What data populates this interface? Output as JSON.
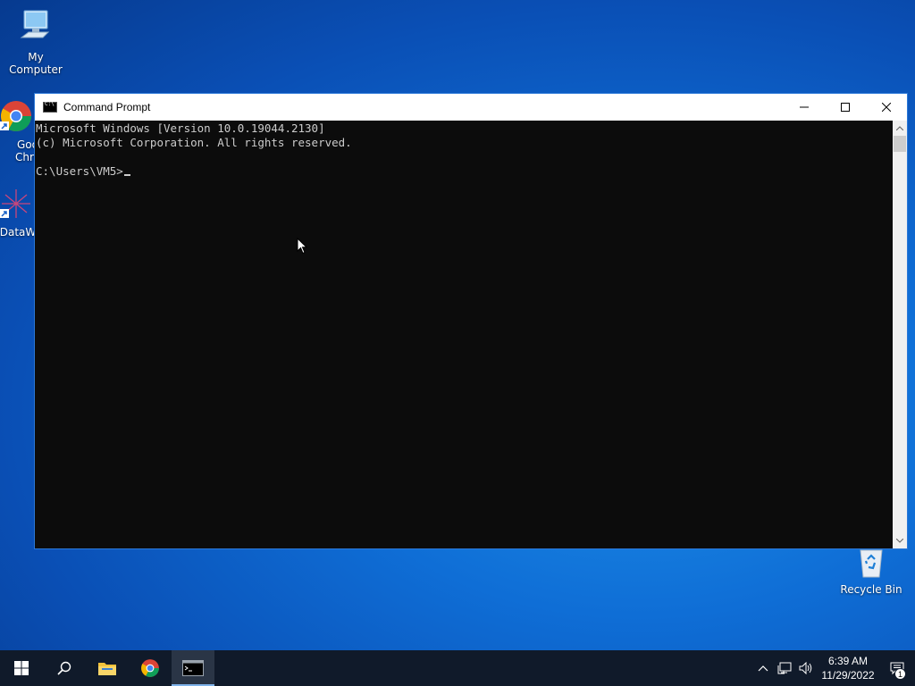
{
  "desktop": {
    "icons": [
      {
        "label": "My Computer"
      },
      {
        "label": "Goo\nChro"
      },
      {
        "label": "DataW"
      },
      {
        "label": "Recycle Bin"
      }
    ]
  },
  "window": {
    "title": "Command Prompt",
    "console_lines": [
      "Microsoft Windows [Version 10.0.19044.2130]",
      "(c) Microsoft Corporation. All rights reserved.",
      "",
      "C:\\Users\\VM5>"
    ]
  },
  "taskbar": {
    "buttons": [
      "start-icon",
      "search-icon",
      "file-explorer-icon",
      "chrome-icon",
      "command-prompt-icon"
    ],
    "time": "6:39 AM",
    "date": "11/29/2022",
    "notification_count": "1"
  },
  "colors": {
    "console_bg": "#0c0c0c",
    "console_text": "#cccccc",
    "taskbar": "#101a2a",
    "window_border": "#2b78d8"
  }
}
